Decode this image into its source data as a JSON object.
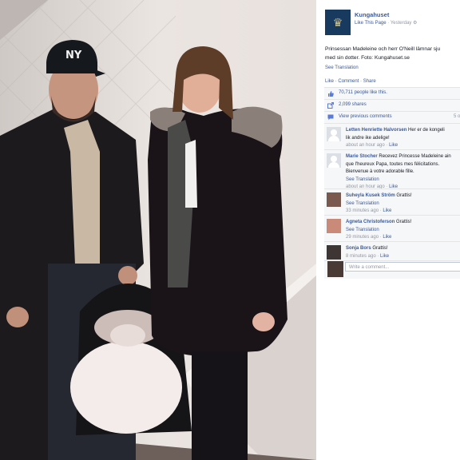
{
  "post": {
    "page_name": "Kungahuset",
    "like_page": "Like This Page",
    "time": "Yesterday",
    "caption_line1": "Prinsessan Madeleine och herr O'Neill lämnar sju",
    "caption_line2": "med sin dotter. Foto: Kungahuset.se",
    "see_translation": "See Translation",
    "actions": [
      "Like",
      "Comment",
      "Share"
    ]
  },
  "stats": {
    "likes": "70,711 people like this.",
    "shares": "2,099 shares",
    "view_previous": "View previous comments",
    "comment_count": "5 o"
  },
  "comments": [
    {
      "name": "Letten Henriette Halvorsen",
      "text1": "Her er de kongeli",
      "text2": "lik andre ike adelige!",
      "time": "about an hour ago",
      "like": "Like",
      "translate": ""
    },
    {
      "name": "Marie Stocher",
      "text1": "Recevez Princesse Madeleine ain",
      "text2": "que l'heureux Papa, toutes mes félicitations.",
      "text3": "Bienvenue à votre adorable fille.",
      "translate": "See Translation",
      "time": "about an hour ago",
      "like": "Like"
    },
    {
      "name": "Suheyla Kusek Ström",
      "text1": "Grattis!",
      "translate": "See Translation",
      "time": "33 minutes ago",
      "like": "Like"
    },
    {
      "name": "Agneta Christoferson",
      "text1": "Grattis!",
      "translate": "See Translation",
      "time": "29 minutes ago",
      "like": "Like"
    },
    {
      "name": "Sonja Bors",
      "text1": "Grattis!",
      "time": "8 minutes ago",
      "like": "Like"
    }
  ],
  "write_comment_placeholder": "Write a comment...",
  "photo": {
    "cap_logo": "NY"
  },
  "colors": {
    "link": "#3b5998",
    "meta": "#9197a3",
    "ufi_bg": "#f6f7f8"
  }
}
